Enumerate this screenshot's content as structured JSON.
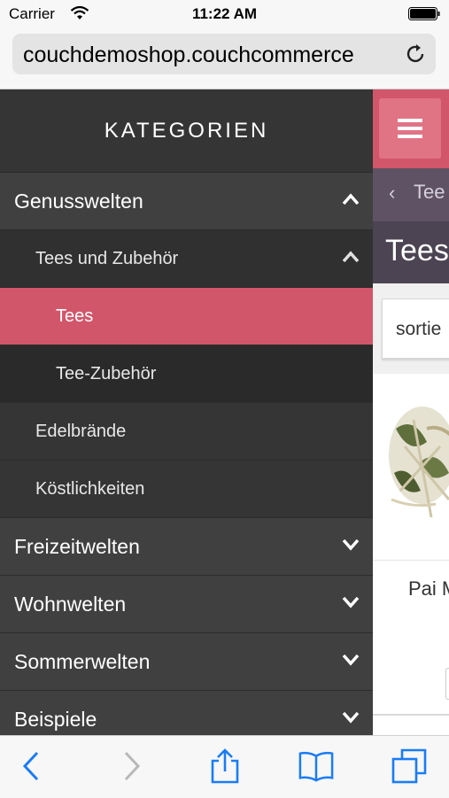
{
  "status": {
    "carrier": "Carrier",
    "time": "11:22 AM"
  },
  "browser": {
    "url": "couchdemoshop.couchcommerce"
  },
  "sidebar": {
    "title": "KATEGORIEN",
    "items": [
      {
        "label": "Genusswelten"
      },
      {
        "label": "Tees und Zubehör"
      },
      {
        "label": "Tees"
      },
      {
        "label": "Tee-Zubehör"
      },
      {
        "label": "Edelbrände"
      },
      {
        "label": "Köstlichkeiten"
      },
      {
        "label": "Freizeitwelten"
      },
      {
        "label": "Wohnwelten"
      },
      {
        "label": "Sommerwelten"
      },
      {
        "label": "Beispiele"
      }
    ]
  },
  "content": {
    "breadcrumb": "Tee",
    "title": "Tees",
    "sort_label": "sortie",
    "product_name": "Pai M"
  },
  "colors": {
    "accent": "#d2566a",
    "sidebar_bg": "#3a3a3a",
    "title_bar": "#4c4452",
    "ios_blue": "#1a7cf5"
  },
  "icons": {
    "toolbar": [
      "back-arrow-icon",
      "forward-arrow-icon",
      "share-icon",
      "bookmarks-icon",
      "tabs-icon"
    ]
  }
}
